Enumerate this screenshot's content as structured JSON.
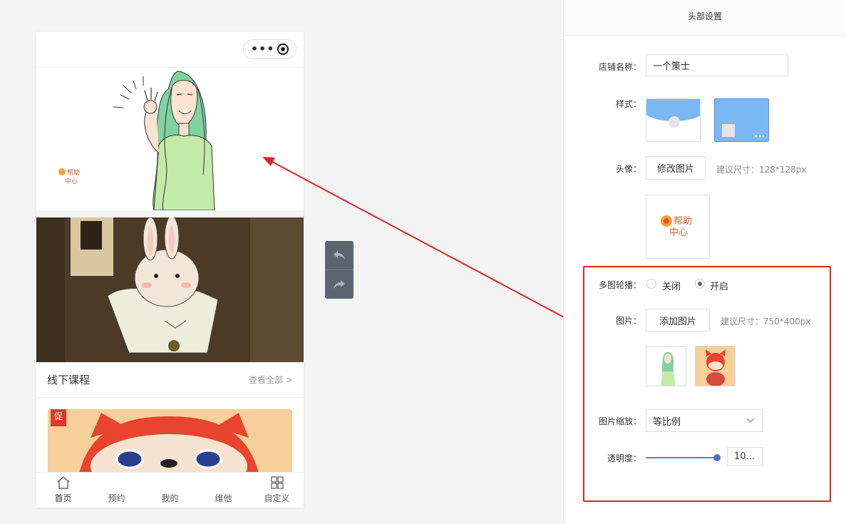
{
  "phone": {
    "capsule_dots": "•••",
    "course_section": {
      "title": "线下课程",
      "more": "查看全部 >",
      "promo_tag": "促"
    },
    "tabs": [
      {
        "label": "首页",
        "icon": "home-icon"
      },
      {
        "label": "预约"
      },
      {
        "label": "我的"
      },
      {
        "label": "维他"
      },
      {
        "label": "自定义",
        "icon": "grid-icon"
      }
    ]
  },
  "panel": {
    "title": "头部设置",
    "shop_name_label": "店铺名称：",
    "shop_name_value": "一个策士",
    "style_label": "样式：",
    "avatar_label": "头像：",
    "avatar_button": "修改图片",
    "avatar_hint": "建议尺寸：128*128px",
    "carousel_label": "多图轮播：",
    "carousel_off": "关闭",
    "carousel_on": "开启",
    "carousel_selected": "开启",
    "image_label": "图片：",
    "image_button": "添加图片",
    "image_hint": "建议尺寸：750*400px",
    "scale_label": "图片缩放：",
    "scale_value": "等比例",
    "opacity_label": "透明度：",
    "opacity_value": "10..."
  },
  "colors": {
    "highlight": "#e02424",
    "accent": "#5b8be8",
    "style_blue": "#7ab8f5"
  }
}
